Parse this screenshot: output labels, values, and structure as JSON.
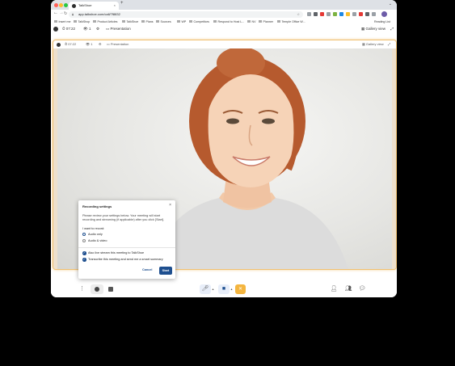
{
  "browser": {
    "tab_title": "TalkShoe",
    "new_tab": "+",
    "tab_close": "×",
    "url": "app.talkshoe.com/call/7f8832",
    "bookmarks": [
      "Insert me",
      "TalkShop",
      "Product Articles",
      "TalkShoe",
      "Plans",
      "Sources",
      "WP",
      "Competitors",
      "Respond to Host L...",
      "NV",
      "Planner",
      "Temple Office W..."
    ],
    "reading_list": "Reading List"
  },
  "app_header": {
    "timer": "07:22",
    "viewers": "1",
    "presentation": "Presentation",
    "gallery": "Gallery view"
  },
  "inner_bar": {
    "timer": "07:22",
    "viewers": "1",
    "presentation": "Presentation",
    "gallery": "Gallery view"
  },
  "dialog": {
    "title": "Recording settings",
    "close": "×",
    "description": "Please review your settings below. Your meeting will start recording and streaming (if applicable) after you click [Start].",
    "want_label": "I want to record:",
    "options": [
      "Audio only",
      "Audio & video"
    ],
    "checks": [
      "Also live stream this meeting to TalkShoe",
      "Transcribe this meeting and send me a smart summary"
    ],
    "cancel": "Cancel",
    "start": "Start"
  },
  "colors": {
    "accent": "#1e4f8f",
    "leave": "#f4b53f",
    "frame_border": "#f0c070"
  },
  "icons": [
    "record-icon",
    "share-screen-icon",
    "mic-icon",
    "camera-icon",
    "leave-icon",
    "add-person-icon",
    "participants-icon",
    "chat-icon"
  ]
}
